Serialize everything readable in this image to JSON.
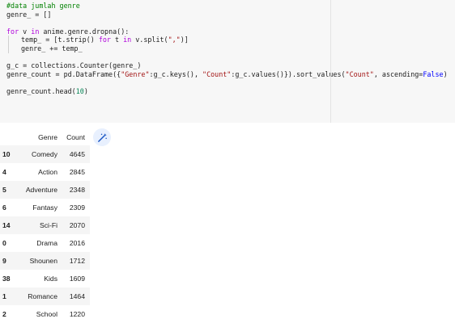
{
  "code_cell": {
    "lines": [
      [
        {
          "t": "#data jumlah genre",
          "c": "cm"
        }
      ],
      [
        {
          "t": "genre_ = []",
          "c": ""
        }
      ],
      [],
      [
        {
          "t": "for",
          "c": "kw"
        },
        {
          "t": " v ",
          "c": ""
        },
        {
          "t": "in",
          "c": "kw"
        },
        {
          "t": " anime.genre.dropna():",
          "c": ""
        }
      ],
      [
        {
          "guide": true
        },
        {
          "t": "temp_ = [t.strip() ",
          "c": ""
        },
        {
          "t": "for",
          "c": "kw"
        },
        {
          "t": " t ",
          "c": ""
        },
        {
          "t": "in",
          "c": "kw"
        },
        {
          "t": " v.split(",
          "c": ""
        },
        {
          "t": "\",\"",
          "c": "str"
        },
        {
          "t": ")]",
          "c": ""
        }
      ],
      [
        {
          "guide": true
        },
        {
          "t": "genre_ += temp_",
          "c": ""
        }
      ],
      [],
      [
        {
          "t": "g_c = collections.Counter(genre_)",
          "c": ""
        }
      ],
      [
        {
          "t": "genre_count = pd.DataFrame({",
          "c": ""
        },
        {
          "t": "\"Genre\"",
          "c": "str"
        },
        {
          "t": ":g_c.keys(), ",
          "c": ""
        },
        {
          "t": "\"Count\"",
          "c": "str"
        },
        {
          "t": ":g_c.values()}).sort_values(",
          "c": ""
        },
        {
          "t": "\"Count\"",
          "c": "str"
        },
        {
          "t": ", ascending=",
          "c": ""
        },
        {
          "t": "False",
          "c": "bool"
        },
        {
          "t": ")",
          "c": ""
        }
      ],
      [],
      [
        {
          "t": "genre_count.head(",
          "c": ""
        },
        {
          "t": "10",
          "c": "num"
        },
        {
          "t": ")",
          "c": ""
        }
      ]
    ]
  },
  "output": {
    "magic_icon": "magic-wand-icon",
    "columns": [
      "",
      "Genre",
      "Count"
    ],
    "rows": [
      {
        "index": "10",
        "genre": "Comedy",
        "count": "4645"
      },
      {
        "index": "4",
        "genre": "Action",
        "count": "2845"
      },
      {
        "index": "5",
        "genre": "Adventure",
        "count": "2348"
      },
      {
        "index": "6",
        "genre": "Fantasy",
        "count": "2309"
      },
      {
        "index": "14",
        "genre": "Sci-Fi",
        "count": "2070"
      },
      {
        "index": "0",
        "genre": "Drama",
        "count": "2016"
      },
      {
        "index": "9",
        "genre": "Shounen",
        "count": "1712"
      },
      {
        "index": "38",
        "genre": "Kids",
        "count": "1609"
      },
      {
        "index": "1",
        "genre": "Romance",
        "count": "1464"
      },
      {
        "index": "2",
        "genre": "School",
        "count": "1220"
      }
    ]
  }
}
